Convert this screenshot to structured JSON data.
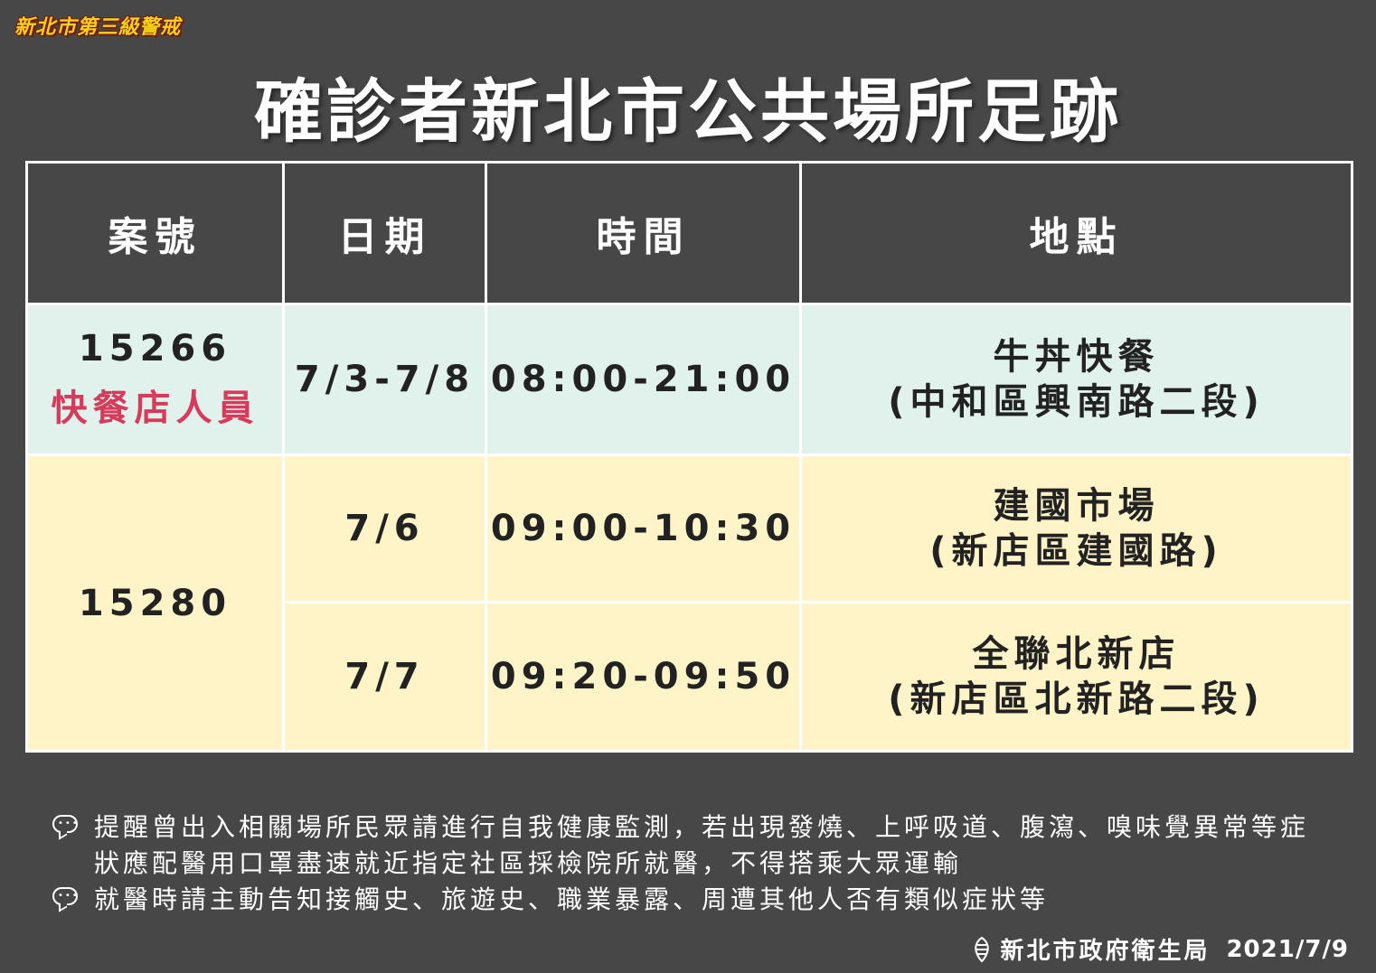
{
  "badge": "新北市第三級警戒",
  "title": "確診者新北市公共場所足跡",
  "table": {
    "headers": [
      "案號",
      "日期",
      "時間",
      "地點"
    ],
    "rows": [
      {
        "case": "15266",
        "case_tag": "快餐店人員",
        "date": "7/3-7/8",
        "time": "08:00-21:00",
        "place_name": "牛丼快餐",
        "place_addr": "(中和區興南路二段)"
      },
      {
        "case": "15280",
        "date": "7/6",
        "time": "09:00-10:30",
        "place_name": "建國市場",
        "place_addr": "(新店區建國路)"
      },
      {
        "date": "7/7",
        "time": "09:20-09:50",
        "place_name": "全聯北新店",
        "place_addr": "(新店區北新路二段)"
      }
    ]
  },
  "notes": [
    "提醒曾出入相關場所民眾請進行自我健康監測，若出現發燒、上呼吸道、腹瀉、嗅味覺異常等症狀應配醫用口罩盡速就近指定社區採檢院所就醫，不得搭乘大眾運輸",
    "就醫時請主動告知接觸史、旅遊史、職業暴露、周遭其他人否有類似症狀等"
  ],
  "footer": {
    "org": "新北市政府衛生局",
    "date": "2021/7/9"
  },
  "colors": {
    "background": "#474747",
    "row_highlight_green": "#e1f1ec",
    "row_highlight_yellow": "#fff3c8",
    "tag_red": "#d63b5c",
    "badge_yellow": "#f6d21c"
  },
  "icons": [
    "chat-bubble-icon",
    "health-bureau-logo-icon"
  ]
}
